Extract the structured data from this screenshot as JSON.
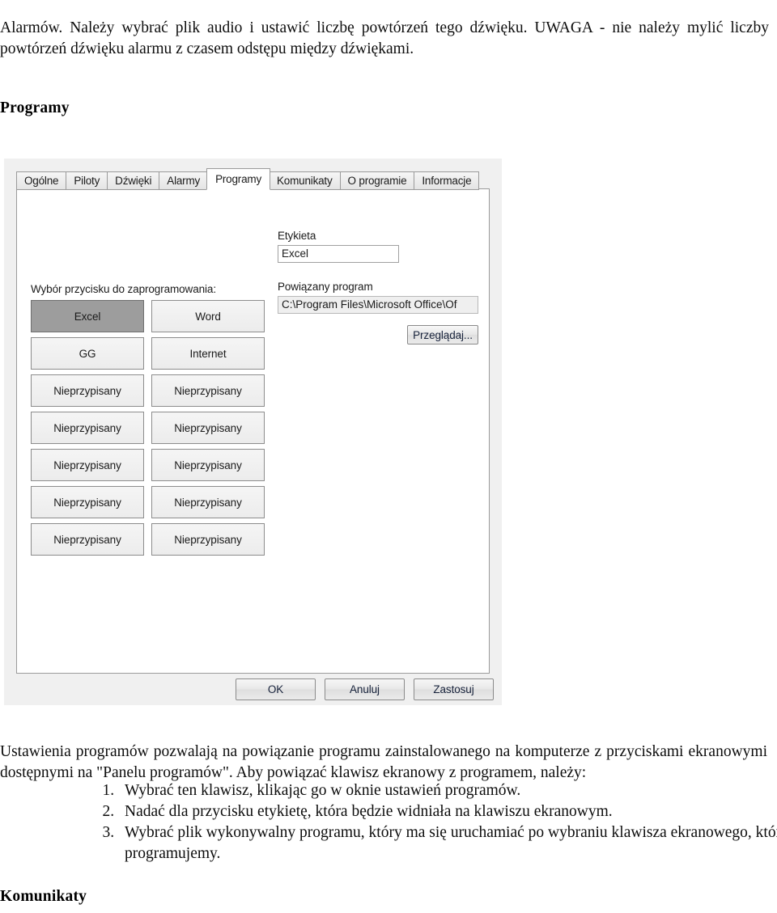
{
  "document": {
    "intro_paragraph": "Alarmów. Należy wybrać plik audio i ustawić liczbę powtórzeń tego dźwięku. UWAGA - nie należy mylić liczby powtórzeń dźwięku alarmu z czasem odstępu między dźwiękami.",
    "section_heading": "Programy",
    "description_paragraph": "Ustawienia programów pozwalają na powiązanie programu zainstalowanego na komputerze z przyciskami ekranowymi dostępnymi na \"Panelu programów\". Aby powiązać klawisz ekranowy z programem, należy:",
    "steps": [
      "Wybrać ten klawisz, klikając go w oknie ustawień programów.",
      "Nadać dla przycisku etykietę, która będzie widniała na klawiszu ekranowym.",
      "Wybrać plik wykonywalny programu, który ma się uruchamiać po wybraniu klawisza ekranowego, który programujemy."
    ],
    "next_heading": "Komunikaty"
  },
  "dialog": {
    "tabs": [
      {
        "label": "Ogólne",
        "active": false
      },
      {
        "label": "Piloty",
        "active": false
      },
      {
        "label": "Dźwięki",
        "active": false
      },
      {
        "label": "Alarmy",
        "active": false
      },
      {
        "label": "Programy",
        "active": true
      },
      {
        "label": "Komunikaty",
        "active": false
      },
      {
        "label": "O programie",
        "active": false
      },
      {
        "label": "Informacje",
        "active": false
      }
    ],
    "buttons_label": "Wybór przycisku do zaprogramowania:",
    "program_buttons": [
      {
        "label": "Excel",
        "selected": true
      },
      {
        "label": "Word",
        "selected": false
      },
      {
        "label": "GG",
        "selected": false
      },
      {
        "label": "Internet",
        "selected": false
      },
      {
        "label": "Nieprzypisany",
        "selected": false
      },
      {
        "label": "Nieprzypisany",
        "selected": false
      },
      {
        "label": "Nieprzypisany",
        "selected": false
      },
      {
        "label": "Nieprzypisany",
        "selected": false
      },
      {
        "label": "Nieprzypisany",
        "selected": false
      },
      {
        "label": "Nieprzypisany",
        "selected": false
      },
      {
        "label": "Nieprzypisany",
        "selected": false
      },
      {
        "label": "Nieprzypisany",
        "selected": false
      },
      {
        "label": "Nieprzypisany",
        "selected": false
      },
      {
        "label": "Nieprzypisany",
        "selected": false
      }
    ],
    "label_field": {
      "caption": "Etykieta",
      "value": "Excel"
    },
    "program_field": {
      "caption": "Powiązany program",
      "value": "C:\\Program Files\\Microsoft Office\\Of"
    },
    "browse_button": "Przeglądaj...",
    "footer": {
      "ok": "OK",
      "cancel": "Anuluj",
      "apply": "Zastosuj"
    },
    "colors": {
      "dialog_background": "#f0f0f0",
      "panel_background": "#ffffff",
      "button_face": "#ececec",
      "selected_button": "#9d9d9d",
      "border": "#9a9a9a"
    }
  }
}
